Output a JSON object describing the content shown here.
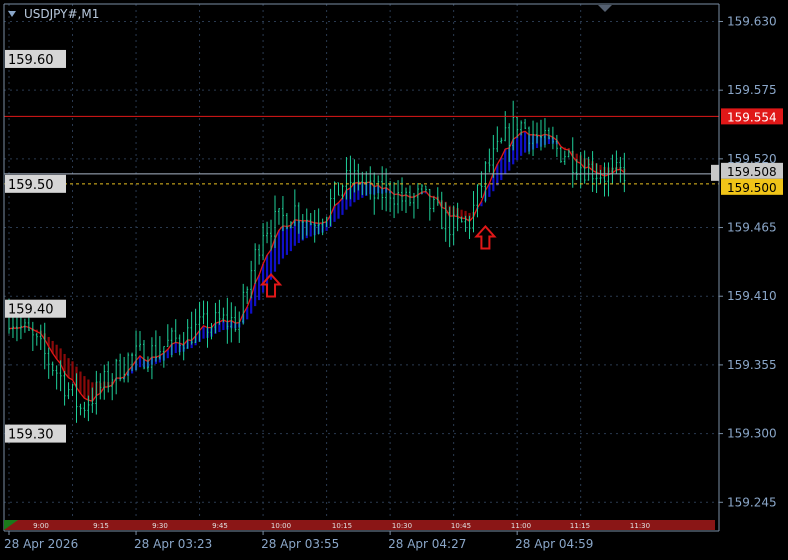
{
  "window": {
    "symbol_title": "USDJPY#,M1",
    "menu_icon": "triangle-down-icon",
    "scroll_marker_icon": "triangle-down-icon"
  },
  "colors": {
    "background": "#000000",
    "axis": "#7a8ea4",
    "axis_text": "#8aa6c8",
    "grid": "#2a3a50",
    "candle": "#1fd09a",
    "ribbon_up": "#1010c8",
    "ribbon_down": "#8a0a0a",
    "fast_line": "#e01818",
    "resistance_line": "#e01818",
    "bid_line": "#aab6c8",
    "ask_line": "#e8c020",
    "arrow": "#e01818",
    "session_bar": "#8a1616",
    "session_bar_start": "#1a7a1a"
  },
  "level_labels": {
    "l1": "159.60",
    "l2": "159.50",
    "l3": "159.40",
    "l4": "159.30"
  },
  "price_badges": {
    "resistance": "159.554",
    "bid": "159.508",
    "ask": "159.500"
  },
  "session_labels": [
    "9:00",
    "9:15",
    "9:30",
    "9:45",
    "10:00",
    "10:15",
    "10:30",
    "10:45",
    "11:00",
    "11:15",
    "11:30"
  ],
  "chart_data": {
    "type": "candlestick",
    "title": "USDJPY#,M1",
    "y_ticks": [
      "159.630",
      "159.575",
      "159.520",
      "159.465",
      "159.410",
      "159.355",
      "159.300",
      "159.245"
    ],
    "ylim": [
      159.222,
      159.644
    ],
    "x_ticks": [
      "28 Apr 2026",
      "28 Apr 03:23",
      "28 Apr 03:55",
      "28 Apr 04:27",
      "28 Apr 04:59"
    ],
    "x_tick_bars": [
      0,
      32,
      64,
      96,
      128
    ],
    "bar_count": 156,
    "grid": true,
    "horizontal_lines": [
      {
        "price": 159.554,
        "role": "resistance"
      },
      {
        "price": 159.508,
        "role": "bid"
      },
      {
        "price": 159.5,
        "role": "ask"
      }
    ],
    "signal_arrows": [
      {
        "bar": 66,
        "direction": "up"
      },
      {
        "bar": 120,
        "direction": "up"
      }
    ],
    "close_path": [
      [
        0,
        159.395
      ],
      [
        6,
        159.375
      ],
      [
        12,
        159.35
      ],
      [
        18,
        159.32
      ],
      [
        24,
        159.34
      ],
      [
        30,
        159.36
      ],
      [
        36,
        159.365
      ],
      [
        42,
        159.375
      ],
      [
        48,
        159.385
      ],
      [
        54,
        159.39
      ],
      [
        58,
        159.39
      ],
      [
        61,
        159.43
      ],
      [
        64,
        159.465
      ],
      [
        68,
        159.47
      ],
      [
        72,
        159.48
      ],
      [
        76,
        159.47
      ],
      [
        80,
        159.48
      ],
      [
        84,
        159.5
      ],
      [
        88,
        159.505
      ],
      [
        92,
        159.49
      ],
      [
        96,
        159.495
      ],
      [
        100,
        159.485
      ],
      [
        104,
        159.49
      ],
      [
        108,
        159.475
      ],
      [
        112,
        159.465
      ],
      [
        116,
        159.47
      ],
      [
        120,
        159.51
      ],
      [
        124,
        159.53
      ],
      [
        128,
        159.55
      ],
      [
        132,
        159.54
      ],
      [
        136,
        159.53
      ],
      [
        140,
        159.525
      ],
      [
        144,
        159.515
      ],
      [
        148,
        159.51
      ],
      [
        152,
        159.505
      ],
      [
        155,
        159.51
      ]
    ]
  }
}
